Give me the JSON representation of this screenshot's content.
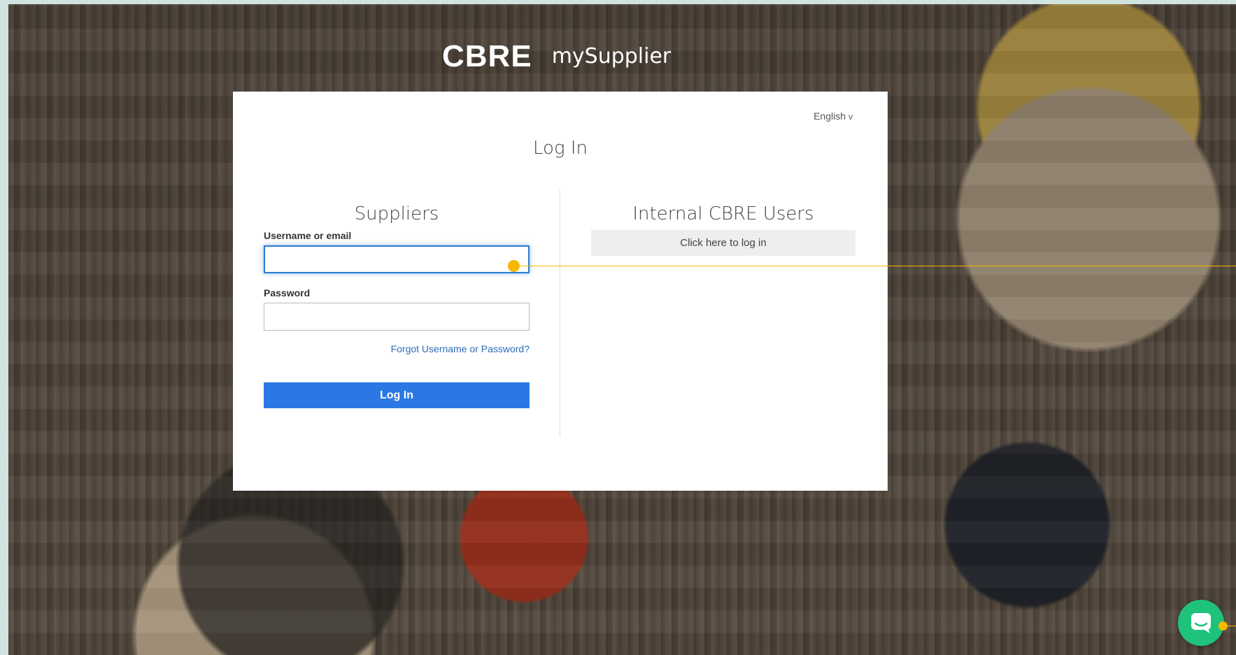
{
  "brand": {
    "logo_text": "CBRE",
    "product_name": "mySupplier"
  },
  "language": {
    "selected": "English",
    "chevron": "v"
  },
  "page": {
    "title": "Log In"
  },
  "suppliers": {
    "heading": "Suppliers",
    "username_label": "Username or email",
    "username_value": "",
    "password_label": "Password",
    "password_value": "",
    "forgot_link": "Forgot Username or Password?",
    "login_button": "Log In"
  },
  "internal": {
    "heading": "Internal CBRE Users",
    "sso_button": "Click here to log in"
  },
  "chat": {
    "icon": "chat-bubble-icon"
  },
  "colors": {
    "primary_button": "#2b78e4",
    "link": "#2a6ebb",
    "focus_border": "#2e7dd1",
    "chat_button": "#1fc27a",
    "marker": "#f5b800"
  }
}
